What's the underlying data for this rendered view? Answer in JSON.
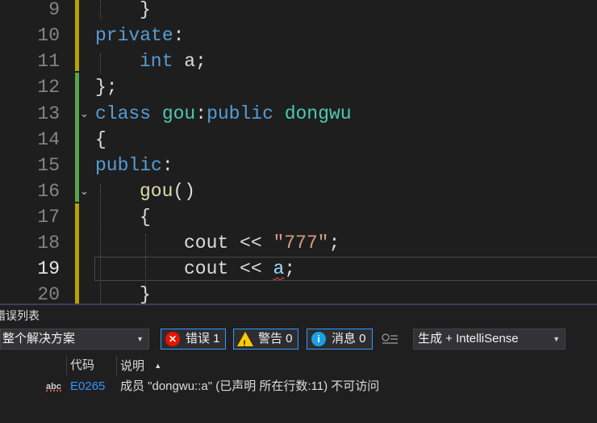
{
  "editor": {
    "lines": [
      {
        "num": "9"
      },
      {
        "num": "10"
      },
      {
        "num": "11"
      },
      {
        "num": "12"
      },
      {
        "num": "13"
      },
      {
        "num": "14"
      },
      {
        "num": "15"
      },
      {
        "num": "16"
      },
      {
        "num": "17"
      },
      {
        "num": "18"
      },
      {
        "num": "19"
      },
      {
        "num": "20"
      }
    ],
    "tokens": {
      "l9_brace": "}",
      "l10_private": "private",
      "l10_colon": ":",
      "l11_int": "int",
      "l11_rest": " a;",
      "l12": "};",
      "l13_class": "class",
      "l13_gou": "gou",
      "l13_colon": ":",
      "l13_public": "public",
      "l13_dongwu": "dongwu",
      "l14": "{",
      "l15_public": "public",
      "l15_colon": ":",
      "l16_gou": "gou",
      "l16_parens": "()",
      "l17": "{",
      "l18_cout": "cout",
      "l18_op": " << ",
      "l18_str": "\"777\"",
      "l18_semi": ";",
      "l19_cout": "cout",
      "l19_op": " << ",
      "l19_a": "a",
      "l19_semi": ";",
      "l20": "}"
    },
    "fold_glyph": "⌄"
  },
  "error_list": {
    "title": "错误列表",
    "scope": "整个解决方案",
    "errors_label": "错误 1",
    "warnings_label": "警告 0",
    "messages_label": "消息 0",
    "build_filter": "生成 + IntelliSense",
    "col_code": "代码",
    "col_desc": "说明",
    "rows": [
      {
        "icon": "abc",
        "code": "E0265",
        "description": "成员 \"dongwu::a\" (已声明 所在行数:11) 不可访问"
      }
    ]
  }
}
